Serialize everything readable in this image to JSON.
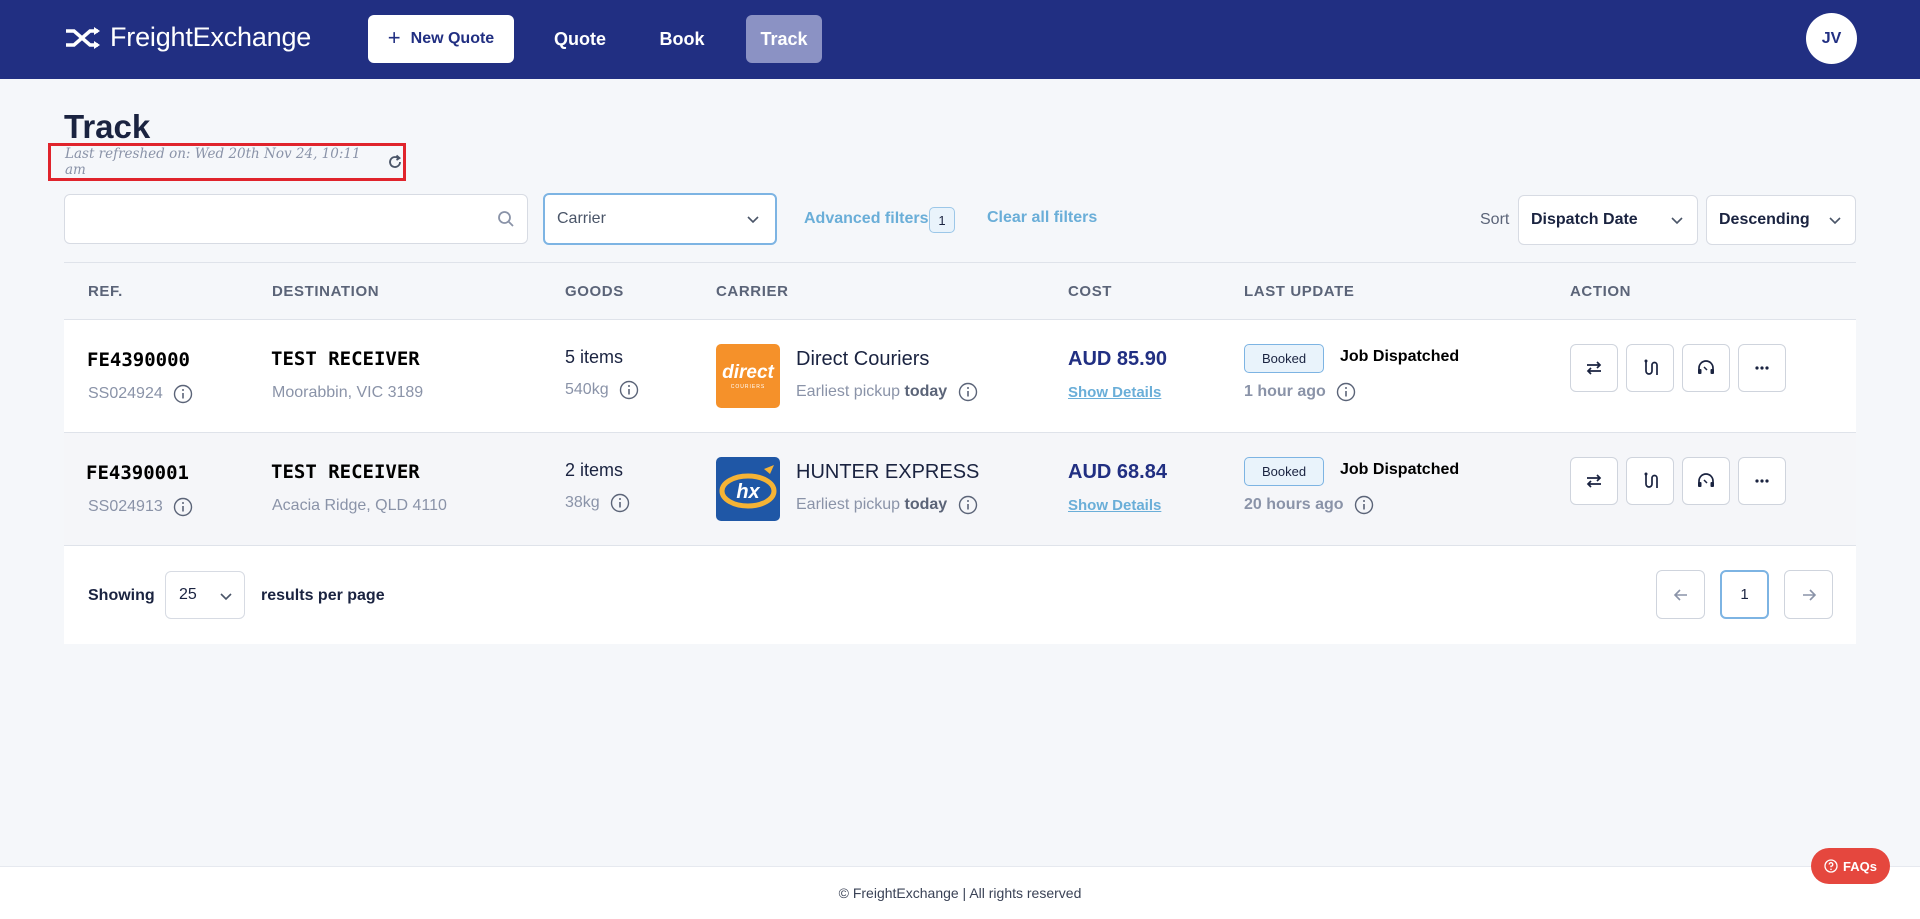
{
  "header": {
    "brand": "FreightExchange",
    "new_quote_label": "New Quote",
    "nav": {
      "quote": "Quote",
      "book": "Book",
      "track": "Track"
    },
    "avatar_initials": "JV"
  },
  "page": {
    "title": "Track",
    "last_refreshed": "Last refreshed on: Wed 20th Nov 24, 10:11 am"
  },
  "filters": {
    "search_value": "",
    "carrier_placeholder": "Carrier",
    "advanced_label": "Advanced filters",
    "advanced_count": "1",
    "clear_label": "Clear all filters",
    "sort_label": "Sort",
    "sort_field": "Dispatch Date",
    "sort_order": "Descending"
  },
  "table": {
    "columns": [
      "REF.",
      "DESTINATION",
      "GOODS",
      "CARRIER",
      "COST",
      "LAST UPDATE",
      "ACTION"
    ],
    "rows": [
      {
        "ref": "FE4390000",
        "sub_ref": "SS024924",
        "dest_name": "TEST RECEIVER",
        "dest_place": "Moorabbin, VIC 3189",
        "items": "5 items",
        "weight": "540kg",
        "carrier": "Direct Couriers",
        "pickup_prefix": "Earliest pickup",
        "pickup_when": "today",
        "cost": "AUD 85.90",
        "details": "Show Details",
        "status": "Booked",
        "update": "Job Dispatched",
        "ago": "1 hour ago"
      },
      {
        "ref": "FE4390001",
        "sub_ref": "SS024913",
        "dest_name": "TEST RECEIVER",
        "dest_place": "Acacia Ridge, QLD 4110",
        "items": "2 items",
        "weight": "38kg",
        "carrier": "HUNTER EXPRESS",
        "pickup_prefix": "Earliest pickup",
        "pickup_when": "today",
        "cost": "AUD 68.84",
        "details": "Show Details",
        "status": "Booked",
        "update": "Job Dispatched",
        "ago": "20 hours ago"
      }
    ]
  },
  "pagination": {
    "showing_label": "Showing",
    "per_page": "25",
    "results_label": "results per page",
    "current_page": "1"
  },
  "footer": {
    "copyright": "© FreightExchange | All rights reserved",
    "faq_label": "FAQs"
  },
  "logo_text": {
    "direct": "direct",
    "direct_sub": "COURIERS",
    "hx": "hx"
  },
  "colors": {
    "header_bg": "#212f82",
    "accent_link": "#6aaed8",
    "highlight_box": "#e0242c",
    "faq_bg": "#e5473e",
    "direct_orange": "#f5912a",
    "hunter_blue": "#1f57a6"
  }
}
